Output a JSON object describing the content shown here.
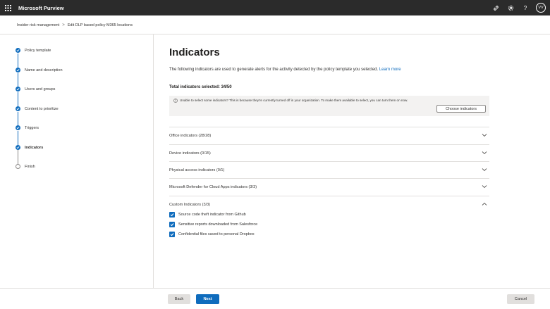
{
  "app": {
    "title": "Microsoft Purview",
    "avatar_initials": "VV",
    "help_label": "?"
  },
  "breadcrumb": {
    "items": [
      "Insider risk management",
      "Edit DLP based policy M365 locations"
    ],
    "separator": ">"
  },
  "wizard": {
    "steps": [
      {
        "label": "Policy template",
        "state": "done"
      },
      {
        "label": "Name and description",
        "state": "done"
      },
      {
        "label": "Users and groups",
        "state": "done"
      },
      {
        "label": "Content to prioritize",
        "state": "done"
      },
      {
        "label": "Triggers",
        "state": "done"
      },
      {
        "label": "Indicators",
        "state": "current"
      },
      {
        "label": "Finish",
        "state": "pending"
      }
    ]
  },
  "main": {
    "title": "Indicators",
    "description": "The following indicators are used to generate alerts for the activity detected by the policy template you selected.",
    "learn_more": "Learn more",
    "total": "Total indicators selected: 34/50",
    "info_message": "Unable to select some indicators? This is because they're currently turned off in your organization. To make them available to select, you can turn them on now.",
    "choose_button": "Choose indicators",
    "sections": [
      {
        "label": "Office indicators (28/28)",
        "expanded": false
      },
      {
        "label": "Device indicators (0/15)",
        "expanded": false
      },
      {
        "label": "Physical access indicators (0/1)",
        "expanded": false
      },
      {
        "label": "Microsoft Defender for Cloud Apps indicators (3/3)",
        "expanded": false
      },
      {
        "label": "Custom Indicators (3/3)",
        "expanded": true
      }
    ],
    "custom_items": [
      {
        "label": "Source code theft indicator from Github",
        "checked": true
      },
      {
        "label": "Sensitive reports downloaded from Salesforce",
        "checked": true
      },
      {
        "label": "Confidential files saved to personal Dropbox",
        "checked": true
      }
    ]
  },
  "footer": {
    "back": "Back",
    "next": "Next",
    "cancel": "Cancel"
  },
  "colors": {
    "accent": "#0f6cbd",
    "topbar": "#2b2b2b"
  },
  "icons": [
    "waffle-icon",
    "link-icon",
    "gear-icon",
    "help-icon",
    "info-icon",
    "chevron-down-icon",
    "chevron-up-icon",
    "checkmark-icon"
  ]
}
